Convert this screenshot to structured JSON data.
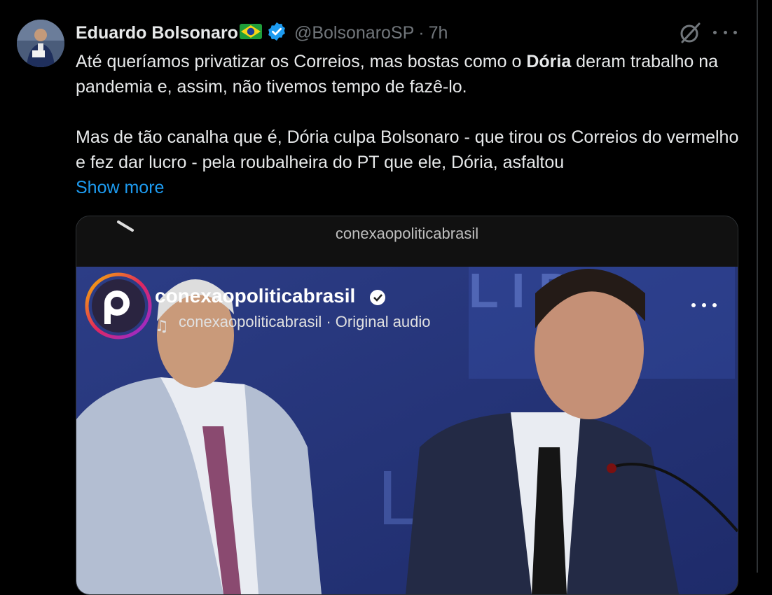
{
  "tweet": {
    "author_name": "Eduardo Bolsonaro",
    "flag_emoji": "🇧🇷",
    "handle": "@BolsonaroSP",
    "separator": "·",
    "time": "7h",
    "text_line1_pre": "Até queríamos privatizar os Correios, mas bostas como o ",
    "text_line1_bold": "Dória",
    "text_line1_post": " deram trabalho na pandemia e, assim, não tivemos tempo de fazê-lo.",
    "text_para2": "Mas de tão canalha que é, Dória culpa Bolsonaro - que tirou os Correios do vermelho e fez dar lucro - pela roubalheira do PT que ele, Dória, asfaltou",
    "show_more": "Show more",
    "icons": {
      "verified": "verified-badge-icon",
      "grok": "grok-icon",
      "more": "more-options-icon"
    },
    "colors": {
      "link": "#1d9bf0",
      "verified": "#1d9bf0",
      "muted": "#71767b",
      "text": "#e7e9ea"
    }
  },
  "media": {
    "watermark": "conexaopoliticabrasil",
    "overlay_handle": "conexaopoliticabrasil",
    "overlay_audio": "conexaopoliticabrasil · Original audio"
  }
}
